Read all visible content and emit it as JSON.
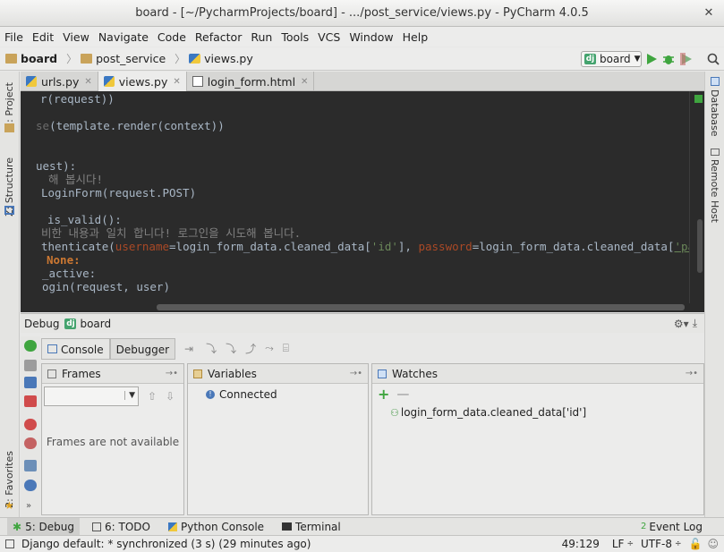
{
  "window": {
    "title": "board - [~/PycharmProjects/board] - .../post_service/views.py - PyCharm 4.0.5"
  },
  "menu": [
    "File",
    "Edit",
    "View",
    "Navigate",
    "Code",
    "Refactor",
    "Run",
    "Tools",
    "VCS",
    "Window",
    "Help"
  ],
  "breadcrumb": [
    "board",
    "post_service",
    "views.py"
  ],
  "run_config": {
    "label": "board",
    "badge": "dj"
  },
  "left_strip": {
    "project": "1: Project",
    "structure": "Z: Structure",
    "favorites": "2: Favorites"
  },
  "right_strip": {
    "database": "Database",
    "remote": "Remote Host"
  },
  "tabs": [
    {
      "label": "urls.py",
      "active": false
    },
    {
      "label": "views.py",
      "active": true
    },
    {
      "label": "login_form.html",
      "active": false
    }
  ],
  "code": {
    "l1": "r(request))",
    "l2a": "se",
    "l2b": "(template.render(context))",
    "l3": "uest):",
    "l4": "해 봅시다!",
    "l5": "LoginForm(request.POST)",
    "l6": "is_valid():",
    "l7": "비한 내용과 일치 합니다! 로그인을 시도해 봅니다.",
    "l8_pre": "thenticate(",
    "l8_p1": "username",
    "l8_mid1": "=login_form_data.cleaned_data[",
    "l8_s1": "'id'",
    "l8_mid2": "], ",
    "l8_p2": "password",
    "l8_mid3": "=login_form_data.cleaned_data[",
    "l8_s2": "'password'",
    "l8_end": "])",
    "l9": "None:",
    "l10": "_active:",
    "l11": "ogin(request, user)"
  },
  "debug": {
    "title": "Debug",
    "config": "board",
    "tabs": [
      "Console",
      "Debugger"
    ],
    "frames_title": "Frames",
    "frames_empty": "Frames are not available",
    "variables_title": "Variables",
    "variables_status": "Connected",
    "watches_title": "Watches",
    "watch_item": "login_form_data.cleaned_data['id']"
  },
  "bottom_tabs": [
    {
      "num": "5",
      "label": "5: Debug"
    },
    {
      "num": "6",
      "label": "6: TODO"
    },
    {
      "label": "Python Console"
    },
    {
      "label": "Terminal"
    }
  ],
  "event_log": {
    "count": "2",
    "label": "Event Log"
  },
  "status": {
    "message": "Django default: * synchronized (3 s) (29 minutes ago)",
    "position": "49:129",
    "line_sep": "LF",
    "encoding": "UTF-8"
  },
  "colors": {
    "editor_bg": "#2b2b2b",
    "code_default": "#a9b7c6",
    "keyword": "#cc7832",
    "param": "#aa4926",
    "string": "#6a8759"
  }
}
